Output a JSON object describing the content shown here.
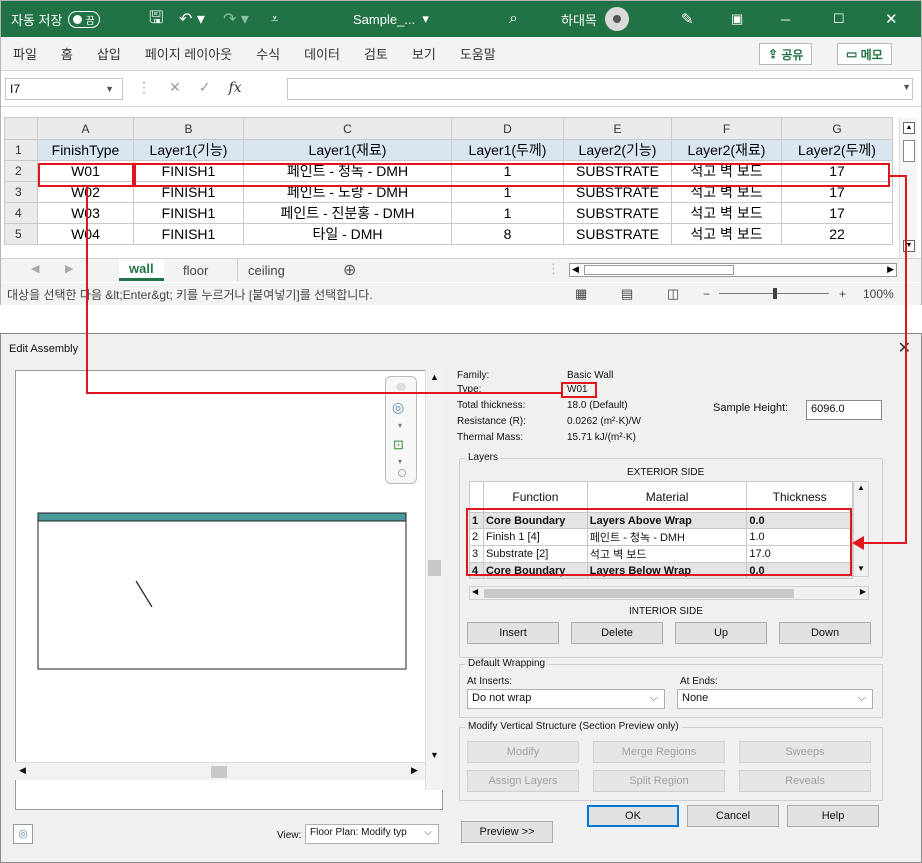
{
  "excel": {
    "autosave_label": "자동 저장",
    "autosave_state": "끔",
    "filename": "Sample_...",
    "filename_caret": "▾",
    "search_glyph": "⌕",
    "user_name": "하대목",
    "window_controls": [
      "─",
      "☐",
      "✕"
    ],
    "menu": [
      "파일",
      "홈",
      "삽입",
      "페이지 레이아웃",
      "수식",
      "데이터",
      "검토",
      "보기",
      "도움말"
    ],
    "share_label": "공유",
    "memo_label": "메모",
    "namebox_value": "I7",
    "fx_label": "fx",
    "columns": [
      "A",
      "B",
      "C",
      "D",
      "E",
      "F",
      "G"
    ],
    "rows": [
      {
        "num": "1",
        "cells": [
          "FinishType",
          "Layer1(기능)",
          "Layer1(재료)",
          "Layer1(두께)",
          "Layer2(기능)",
          "Layer2(재료)",
          "Layer2(두께)"
        ]
      },
      {
        "num": "2",
        "cells": [
          "W01",
          "FINISH1",
          "페인트 - 청녹 - DMH",
          "1",
          "SUBSTRATE",
          "석고 벽 보드",
          "17"
        ]
      },
      {
        "num": "3",
        "cells": [
          "W02",
          "FINISH1",
          "페인트 - 노랑 - DMH",
          "1",
          "SUBSTRATE",
          "석고 벽 보드",
          "17"
        ]
      },
      {
        "num": "4",
        "cells": [
          "W03",
          "FINISH1",
          "페인트 - 진분홍 - DMH",
          "1",
          "SUBSTRATE",
          "석고 벽 보드",
          "17"
        ]
      },
      {
        "num": "5",
        "cells": [
          "W04",
          "FINISH1",
          "타일 - DMH",
          "8",
          "SUBSTRATE",
          "석고 벽 보드",
          "22"
        ]
      }
    ],
    "sheet_tabs": [
      "wall",
      "floor",
      "ceiling"
    ],
    "active_tab": "wall",
    "status_text": "대상을 선택한 다음 &lt;Enter&gt; 키를 누르거나 [붙여넣기]를 선택합니다.",
    "zoom": "100%"
  },
  "revit": {
    "title": "Edit Assembly",
    "family_label": "Family:",
    "family_value": "Basic Wall",
    "type_label": "Type:",
    "type_value": "W01",
    "total_thickness_label": "Total thickness:",
    "total_thickness_value": "18.0 (Default)",
    "resistance_label": "Resistance (R):",
    "resistance_value": "0.0262 (m²·K)/W",
    "thermal_mass_label": "Thermal Mass:",
    "thermal_mass_value": "15.71 kJ/(m²·K)",
    "sample_height_label": "Sample Height:",
    "sample_height_value": "6096.0",
    "layers_label": "Layers",
    "exterior_side": "EXTERIOR SIDE",
    "interior_side": "INTERIOR SIDE",
    "layer_headers": [
      "Function",
      "Material",
      "Thickness"
    ],
    "layers": [
      {
        "num": "1",
        "function": "Core Boundary",
        "material": "Layers Above Wrap",
        "thickness": "0.0",
        "core": true
      },
      {
        "num": "2",
        "function": "Finish 1 [4]",
        "material": "페인트 - 청녹 - DMH",
        "thickness": "1.0",
        "core": false
      },
      {
        "num": "3",
        "function": "Substrate [2]",
        "material": "석고 벽 보드",
        "thickness": "17.0",
        "core": false
      },
      {
        "num": "4",
        "function": "Core Boundary",
        "material": "Layers Below Wrap",
        "thickness": "0.0",
        "core": true
      }
    ],
    "layer_buttons": [
      "Insert",
      "Delete",
      "Up",
      "Down"
    ],
    "default_wrapping_label": "Default Wrapping",
    "at_inserts_label": "At Inserts:",
    "at_inserts_value": "Do not wrap",
    "at_ends_label": "At Ends:",
    "at_ends_value": "None",
    "mvs_label": "Modify Vertical Structure (Section Preview only)",
    "mvs_buttons": [
      "Modify",
      "Merge Regions",
      "Sweeps",
      "Assign Layers",
      "Split Region",
      "Reveals"
    ],
    "view_label": "View:",
    "view_value": "Floor Plan: Modify typ",
    "preview_button": "Preview >>",
    "ok": "OK",
    "cancel": "Cancel",
    "help": "Help"
  },
  "colors": {
    "excel_green": "#217346",
    "highlight_red": "#e0161c",
    "wall_finish": "#4a9a9a"
  }
}
